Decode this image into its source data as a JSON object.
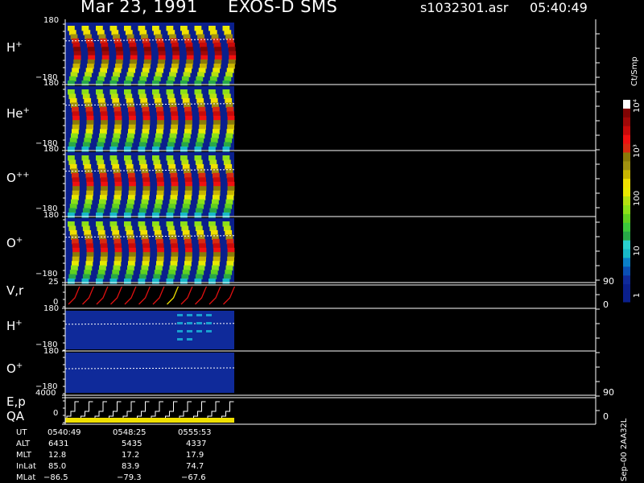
{
  "header": {
    "date": "Mar 23, 1991",
    "instrument": "EXOS-D SMS",
    "filename": "s1032301.asr",
    "time": "05:40:49"
  },
  "panels": [
    {
      "label": "H",
      "sup": "+",
      "ymax": "180",
      "ymin": "−180"
    },
    {
      "label": "He",
      "sup": "+",
      "ymax": "180",
      "ymin": "−180"
    },
    {
      "label": "O",
      "sup": "++",
      "ymax": "180",
      "ymin": "−180"
    },
    {
      "label": "O",
      "sup": "+",
      "ymax": "180",
      "ymin": "−180"
    },
    {
      "label": "V,r",
      "sup": "",
      "ymax": "25",
      "ymin": "0",
      "rmax": "90",
      "rmin": "0"
    },
    {
      "label": "H",
      "sup": "+",
      "ymax": "180",
      "ymin": "−180"
    },
    {
      "label": "O",
      "sup": "+",
      "ymax": "180",
      "ymin": "−180"
    },
    {
      "label": "E,p",
      "sup": "",
      "label2": "QA",
      "ymax": "4000",
      "ymin": "0",
      "rmax": "90",
      "rmin": "0"
    }
  ],
  "colorbar": {
    "unit": "Ct/Smp",
    "ticks": [
      "1",
      "10",
      "100",
      "10³",
      "10⁴"
    ],
    "colors": [
      "#0a1f8c",
      "#0a1f8c",
      "#0f2a9a",
      "#0a4fb4",
      "#0a7fc8",
      "#18b8c8",
      "#2ad0d0",
      "#28a848",
      "#3cc83c",
      "#60d020",
      "#8ce018",
      "#b4e010",
      "#e8e800",
      "#f0e000",
      "#c8b400",
      "#a09010",
      "#8a7a08",
      "#d82a10",
      "#f01010",
      "#c80a0a",
      "#a00808",
      "#800404",
      "#ffffff"
    ]
  },
  "orbit": {
    "labels": [
      "UT",
      "ALT",
      "MLT",
      "InLat",
      "MLat"
    ],
    "columns": [
      [
        "0540:49",
        "6431",
        "12.8",
        "85.0",
        "−86.5"
      ],
      [
        "0548:25",
        "5435",
        "17.2",
        "83.9",
        "−79.3"
      ],
      [
        "0555:53",
        "4337",
        "17.9",
        "74.7",
        "−67.6"
      ]
    ]
  },
  "footer_code": "Sep–00  2AA32L",
  "chart_data": {
    "type": "heatmap",
    "title": "Mar 23, 1991   EXOS-D SMS",
    "xlabel": "UT",
    "x_ticks": [
      "0540:49",
      "0548:25",
      "0555:53"
    ],
    "colorbar_unit": "Ct/Smp",
    "colorbar_scale": "log",
    "colorbar_range": [
      1,
      10000
    ],
    "series": [
      {
        "name": "H+",
        "ylim": [
          -180,
          180
        ],
        "spin_sweeps": 12,
        "peak_level": "10^3"
      },
      {
        "name": "He+",
        "ylim": [
          -180,
          180
        ],
        "spin_sweeps": 12,
        "peak_level": "10^3"
      },
      {
        "name": "O++",
        "ylim": [
          -180,
          180
        ],
        "spin_sweeps": 12,
        "peak_level": "10^3"
      },
      {
        "name": "O+",
        "ylim": [
          -180,
          180
        ],
        "spin_sweeps": 12,
        "peak_level": "10^3"
      },
      {
        "name": "V,r",
        "ylim": [
          0,
          25
        ],
        "right_ylim": [
          0,
          90
        ]
      },
      {
        "name": "H+",
        "ylim": [
          -180,
          180
        ]
      },
      {
        "name": "O+",
        "ylim": [
          -180,
          180
        ]
      },
      {
        "name": "E,p",
        "ylim": [
          0,
          4000
        ],
        "right_ylim": [
          0,
          90
        ]
      }
    ]
  }
}
